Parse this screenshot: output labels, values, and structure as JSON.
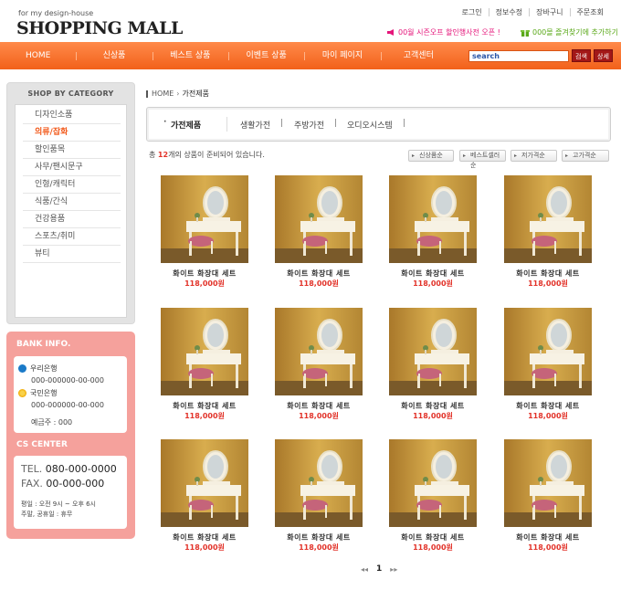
{
  "header": {
    "logo_sub": "for my design-house",
    "logo_main": "SHOPPING MALL",
    "top_links": [
      "로그인",
      "정보수정",
      "장바구니",
      "주문조회"
    ],
    "promo_left": "00월 시즌오프 할인행사전 오픈 !",
    "promo_right": "000몰 즐겨찾기에 추가하기"
  },
  "nav": {
    "items": [
      "HOME",
      "신상품",
      "베스트 상품",
      "이벤트 상품",
      "마이 페이지",
      "고객센터"
    ],
    "search_value": "search",
    "search_button": "검색",
    "detail_button": "상세"
  },
  "sidebar": {
    "category_title": "SHOP BY CATEGORY",
    "categories": [
      "디자인소품",
      "의류/잡화",
      "할인품목",
      "사무/팬시문구",
      "인형/캐릭터",
      "식품/간식",
      "건강용품",
      "스포츠/취미",
      "뷰티"
    ],
    "active_category": "의류/잡화",
    "bank": {
      "title": "BANK INFO.",
      "banks": [
        {
          "name": "우리은행",
          "account": "000-000000-00-000",
          "icon": "woori-bank-icon"
        },
        {
          "name": "국민은행",
          "account": "000-000000-00-000",
          "icon": "kb-bank-icon"
        }
      ],
      "depositor": "예금주 : 000"
    },
    "cs": {
      "title": "CS CENTER",
      "tel_label": "TEL.",
      "tel": "080-000-0000",
      "fax_label": "FAX.",
      "fax": "00-000-000",
      "weekday": "평일 : 오전 9시 ~ 오후 6시",
      "weekend": "주말, 공휴일 : 휴무"
    }
  },
  "main": {
    "breadcrumb": {
      "home": "HOME",
      "current": "가전제품"
    },
    "subcategories": {
      "active": "가전제품",
      "links": [
        "생활가전",
        "주방가전",
        "오디오시스템"
      ]
    },
    "count": {
      "prefix": "총",
      "num": "12",
      "suffix": "개의 상품이 준비되어 있습니다."
    },
    "sort_buttons": [
      "신상품순",
      "베스트셀러순",
      "저가격순",
      "고가격순"
    ],
    "products": [
      {
        "name": "화이트 화장대 세트",
        "price": "118,000원"
      },
      {
        "name": "화이트 화장대 세트",
        "price": "118,000원"
      },
      {
        "name": "화이트 화장대 세트",
        "price": "118,000원"
      },
      {
        "name": "화이트 화장대 세트",
        "price": "118,000원"
      },
      {
        "name": "화이트 화장대 세트",
        "price": "118,000원"
      },
      {
        "name": "화이트 화장대 세트",
        "price": "118,000원"
      },
      {
        "name": "화이트 화장대 세트",
        "price": "118,000원"
      },
      {
        "name": "화이트 화장대 세트",
        "price": "118,000원"
      },
      {
        "name": "화이트 화장대 세트",
        "price": "118,000원"
      },
      {
        "name": "화이트 화장대 세트",
        "price": "118,000원"
      },
      {
        "name": "화이트 화장대 세트",
        "price": "118,000원"
      },
      {
        "name": "화이트 화장대 세트",
        "price": "118,000원"
      }
    ],
    "pager": {
      "prev": "◂◂",
      "current": "1",
      "next": "▸▸"
    }
  },
  "colors": {
    "nav_orange": "#f2611a",
    "price_red": "#e2332a",
    "active_orange": "#f25a1c",
    "side_pink": "#f5a19c",
    "promo_pink": "#e5157a",
    "promo_green": "#5aa818"
  }
}
